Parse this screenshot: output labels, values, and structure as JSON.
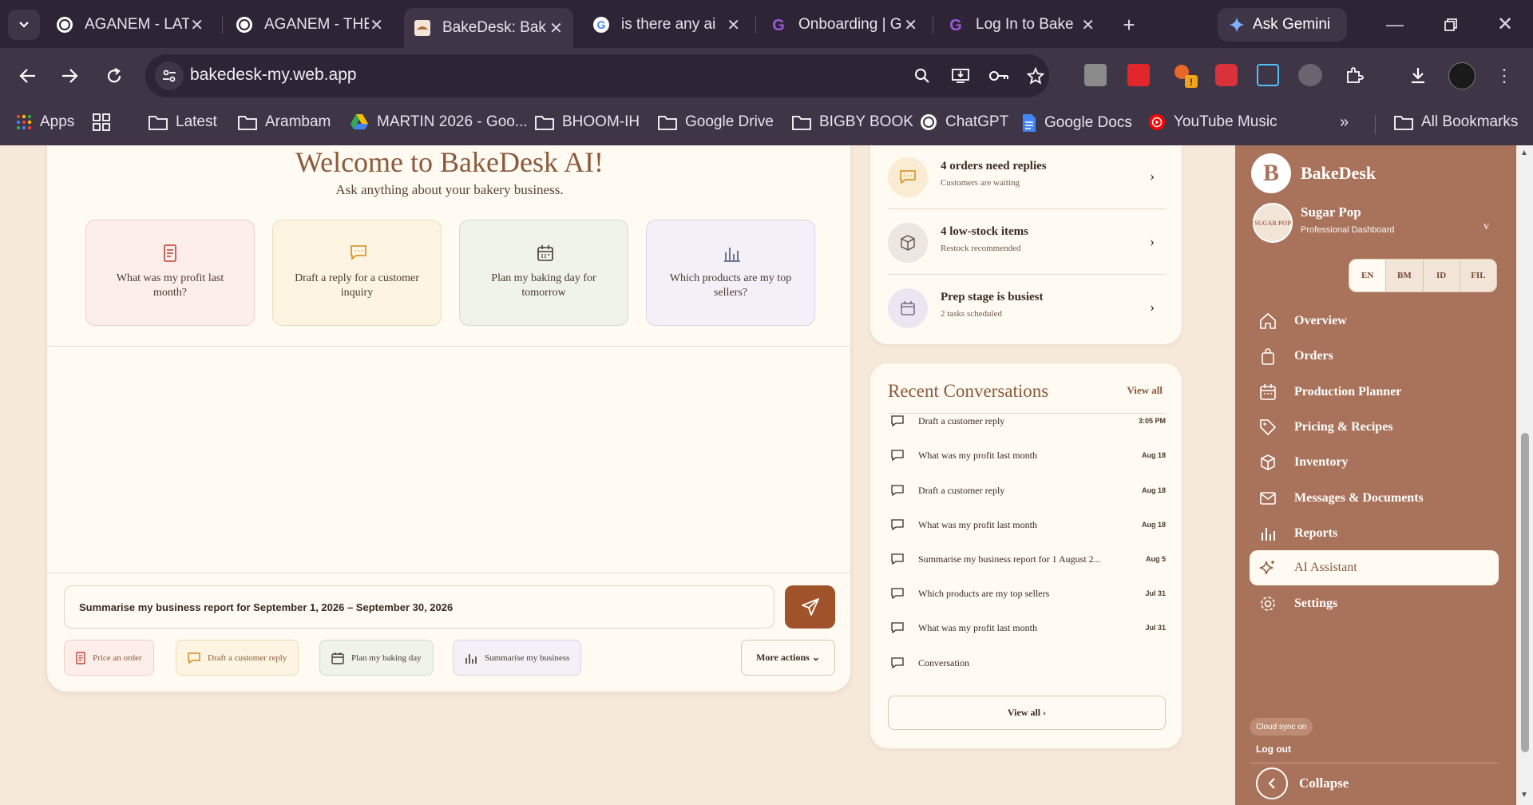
{
  "browser": {
    "tabs": [
      {
        "title": "AGANEM - LAT",
        "favicon": "chatgpt-icon"
      },
      {
        "title": "AGANEM - THE",
        "favicon": "chatgpt-icon"
      },
      {
        "title": "BakeDesk: Bak",
        "favicon": "bakedesk-icon"
      },
      {
        "title": "is there any ai",
        "favicon": "google-icon"
      },
      {
        "title": "Onboarding | G",
        "favicon": "g-icon"
      },
      {
        "title": "Log In to Bake",
        "favicon": "g-icon"
      }
    ],
    "gemini_label": "Ask Gemini",
    "url": "bakedesk-my.web.app",
    "bookmarks": [
      "Apps",
      "Latest",
      "Arambam",
      "MARTIN 2026 - Goo...",
      "BHOOM-IH",
      "Google Drive",
      "BIGBY BOOK",
      "ChatGPT",
      "Google Docs",
      "YouTube Music",
      "All Bookmarks"
    ]
  },
  "chat": {
    "title": "Welcome to BakeDesk AI!",
    "subtitle": "Ask anything about your bakery business.",
    "suggestions": [
      {
        "line1": "What was my profit last",
        "line2": "month?",
        "icon": "receipt-icon"
      },
      {
        "line1": "Draft a reply for a customer",
        "line2": "inquiry",
        "icon": "message-icon"
      },
      {
        "line1": "Plan my baking day for",
        "line2": "tomorrow",
        "icon": "calendar-icon"
      },
      {
        "line1": "Which products are my top",
        "line2": "sellers?",
        "icon": "bar-chart-icon"
      }
    ],
    "input_value": "Summarise my business report for September 1, 2026 – September 30, 2026",
    "quick_actions": [
      "Price an order",
      "Draft a customer reply",
      "Plan my baking day",
      "Summarise my business"
    ],
    "more_actions": "More actions ⌄"
  },
  "alerts": [
    {
      "title": "4 orders need replies",
      "subtitle": "Customers are waiting",
      "icon": "message-icon",
      "color": "#f9ecd3"
    },
    {
      "title": "4 low-stock items",
      "subtitle": "Restock recommended",
      "icon": "box-icon",
      "color": "#ece7e2"
    },
    {
      "title": "Prep stage is busiest",
      "subtitle": "2 tasks scheduled",
      "icon": "calendar-icon",
      "color": "#ece6f3"
    }
  ],
  "conversations": {
    "title": "Recent Conversations",
    "view_all_link": "View all",
    "items": [
      {
        "title": "Draft a customer reply",
        "date": "3:05 PM"
      },
      {
        "title": "What was my profit last month",
        "date": "Aug 18"
      },
      {
        "title": "Draft a customer reply",
        "date": "Aug 18"
      },
      {
        "title": "What was my profit last month",
        "date": "Aug 18"
      },
      {
        "title": "Summarise my business report for 1 August 2...",
        "date": "Aug 5"
      },
      {
        "title": "Which products are my top sellers",
        "date": "Jul 31"
      },
      {
        "title": "What was my profit last month",
        "date": "Jul 31"
      },
      {
        "title": "Conversation",
        "date": ""
      }
    ],
    "view_all_button": "View all ›"
  },
  "sidebar": {
    "logo_letter": "B",
    "brand": "BakeDesk",
    "bakery_name": "Sugar Pop",
    "bakery_sub": "Professional Dashboard",
    "avatar_text": "SUGAR POP",
    "chevron": "v",
    "languages": [
      "EN",
      "BM",
      "ID",
      "FIL"
    ],
    "active_language": "EN",
    "nav": [
      {
        "label": "Overview",
        "icon": "home-icon"
      },
      {
        "label": "Orders",
        "icon": "bag-icon"
      },
      {
        "label": "Production Planner",
        "icon": "calendar-icon"
      },
      {
        "label": "Pricing & Recipes",
        "icon": "tag-icon"
      },
      {
        "label": "Inventory",
        "icon": "box-icon"
      },
      {
        "label": "Messages & Documents",
        "icon": "mail-icon"
      },
      {
        "label": "Reports",
        "icon": "bar-chart-icon"
      },
      {
        "label": "AI Assistant",
        "icon": "sparkle-icon"
      },
      {
        "label": "Settings",
        "icon": "gear-icon"
      }
    ],
    "active_nav": "AI Assistant",
    "cloud_sync": "Cloud sync on",
    "logout": "Log out",
    "collapse": "Collapse"
  }
}
